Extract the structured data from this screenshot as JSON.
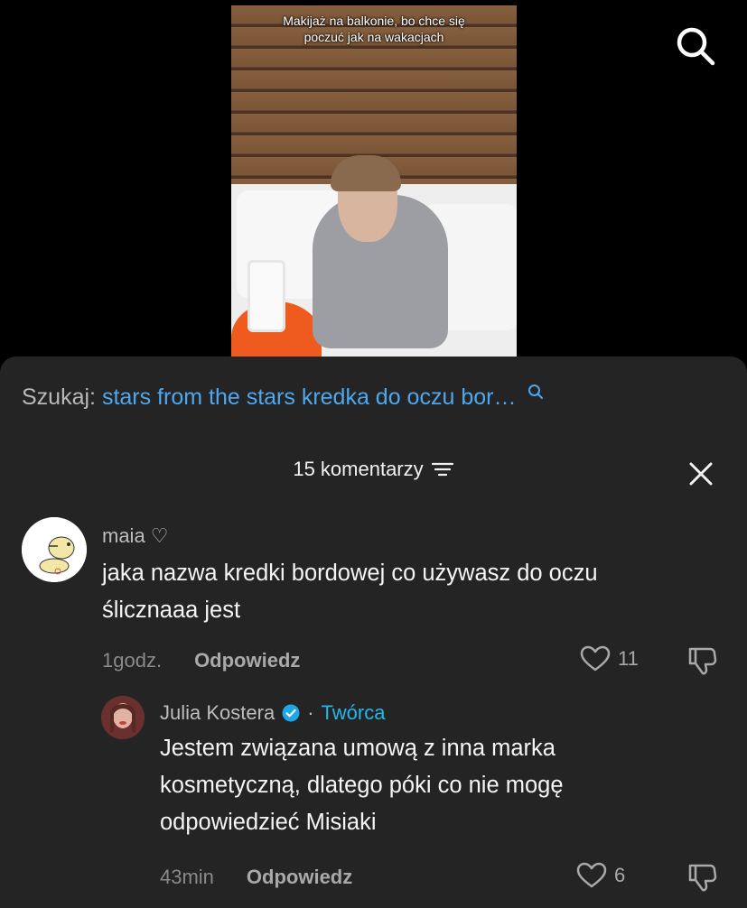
{
  "video": {
    "caption": "Makijaż na balkonie, bo chce się poczuć jak na wakacjach"
  },
  "search_suggestion": {
    "label": "Szukaj:",
    "query": "stars from the stars kredka do oczu bor…"
  },
  "comments_header": {
    "count_label": "15 komentarzy"
  },
  "comments": [
    {
      "username": "maia ♡",
      "text_line1": "jaka nazwa kredki bordowej co używasz do oczu",
      "text_line2": "ślicznaaa jest",
      "time": "1godz.",
      "reply_label": "Odpowiedz",
      "likes": "11"
    },
    {
      "username": "Julia Kostera",
      "separator": "·",
      "badge": "Twórca",
      "text_line1": "Jestem związana umową z inna marka",
      "text_line2": "kosmetyczną, dlatego póki co nie mogę",
      "text_line3": "odpowiedzieć Misiaki",
      "time": "43min",
      "reply_label": "Odpowiedz",
      "likes": "6"
    }
  ],
  "colors": {
    "sheet_bg": "#242424",
    "link_blue": "#4ea8f0",
    "creator_cyan": "#23b8ea",
    "verified_blue": "#20a5e6"
  },
  "icons": [
    "search-icon",
    "sort-icon",
    "close-icon",
    "heart-icon",
    "dislike-icon",
    "verified-icon"
  ]
}
